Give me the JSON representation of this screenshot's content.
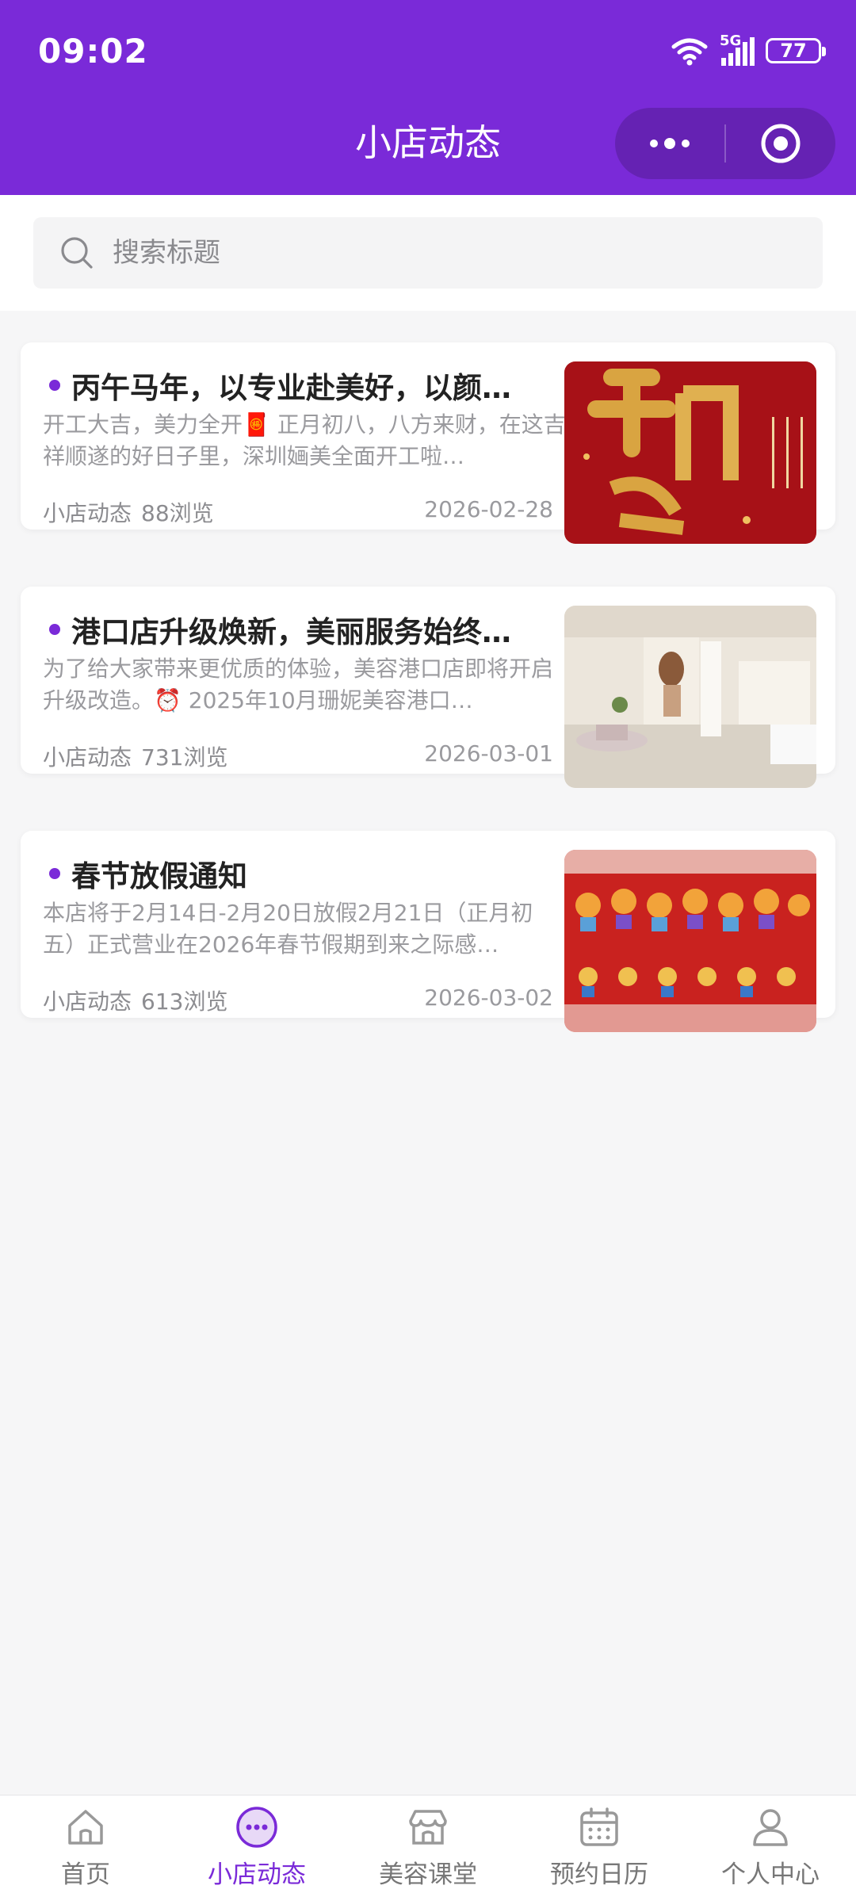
{
  "status": {
    "time": "09:02",
    "network": "5G",
    "battery": "77"
  },
  "header": {
    "title": "小店动态"
  },
  "search": {
    "placeholder": "搜索标题"
  },
  "articles": [
    {
      "title": "丙午马年，以专业赴美好，以颜…",
      "excerpt": "开工大吉，美力全开🧧 正月初八，八方来财，在这吉祥顺遂的好日子里，深圳婳美全面开工啦…",
      "category": "小店动态",
      "views": "88浏览",
      "date": "2026-02-28",
      "thumb_icon": "kaimenhong-red-poster"
    },
    {
      "title": "港口店升级焕新，美丽服务始终…",
      "excerpt": "为了给大家带来更优质的体验，美容港口店即将开启升级改造。⏰ 2025年10月珊妮美容港口…",
      "category": "小店动态",
      "views": "731浏览",
      "date": "2026-03-01",
      "thumb_icon": "salon-interior-photo"
    },
    {
      "title": "春节放假通知",
      "excerpt": "本店将于2月14日-2月20日放假2月21日（正月初五）正式营业在2026年春节假期到来之际感…",
      "category": "小店动态",
      "views": "613浏览",
      "date": "2026-03-02",
      "thumb_icon": "spring-festival-cartoon-poster"
    }
  ],
  "tabbar": {
    "active_index": 1,
    "items": [
      {
        "label": "首页",
        "icon": "home-icon"
      },
      {
        "label": "小店动态",
        "icon": "chat-bubble-icon"
      },
      {
        "label": "美容课堂",
        "icon": "store-icon"
      },
      {
        "label": "预约日历",
        "icon": "calendar-icon"
      },
      {
        "label": "个人中心",
        "icon": "person-icon"
      }
    ]
  },
  "colors": {
    "brand": "#7a2ad8",
    "background": "#f6f6f7"
  }
}
